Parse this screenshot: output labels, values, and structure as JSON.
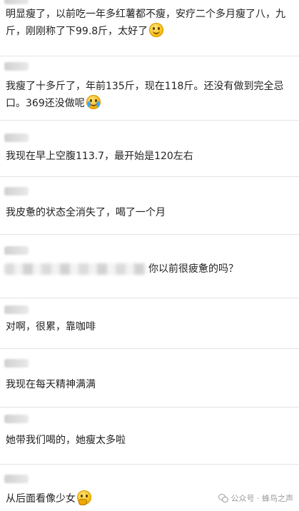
{
  "messages": [
    {
      "text": "明显瘦了，以前吃一年多红薯都不瘦，安疗二个多月瘦了八，九斤，刚刚称了下99.8斤，太好了",
      "emoji": "smile-emoji"
    },
    {
      "text": "我瘦了十多斤了，年前135斤，现在118斤。还没有做到完全忌口。369还没做呢",
      "emoji": "crying-emoji"
    },
    {
      "text": "我现在早上空腹113.7，最开始是120左右"
    },
    {
      "text": "我皮惫的状态全消失了，喝了一个月"
    },
    {
      "text": "你以前很疲惫的吗？"
    },
    {
      "text": "对啊，很累，靠咖啡"
    },
    {
      "text": "我现在每天精神满满"
    },
    {
      "text": "她带我们喝的，她瘦太多啦"
    },
    {
      "text": "从后面看像少女",
      "emoji": "thinking-emoji"
    }
  ],
  "watermark": {
    "label": "公众号 · 蜂鸟之声",
    "icon": "wechat-icon"
  }
}
